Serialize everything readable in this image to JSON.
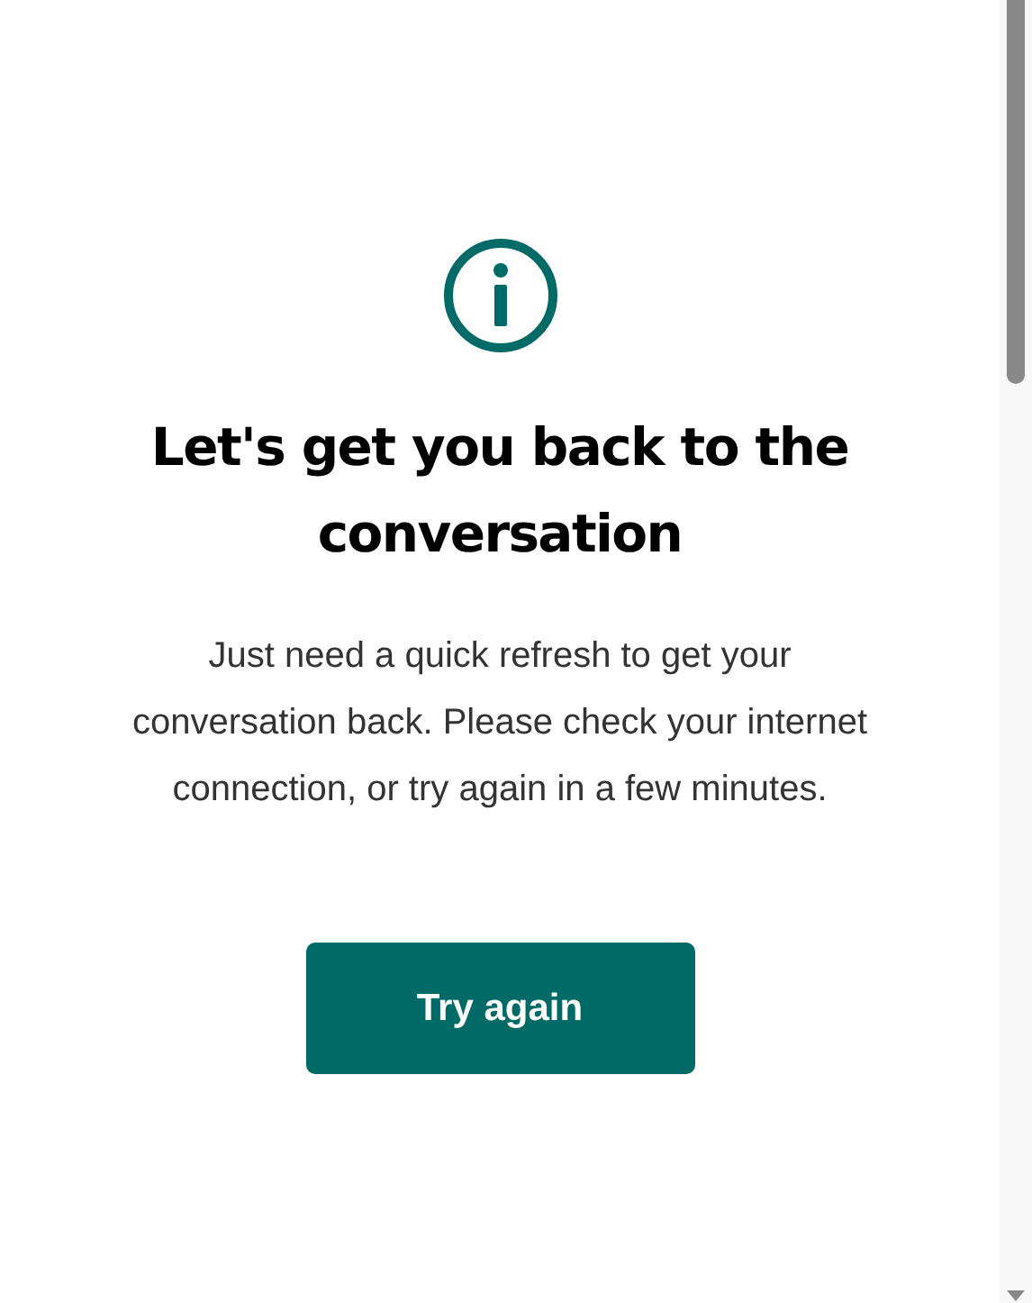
{
  "heading": "Let's get you back to the conversation",
  "message": "Just need a quick refresh to get your conversation back. Please check your internet connection, or try again in a few minutes.",
  "button": {
    "label": "Try again"
  }
}
